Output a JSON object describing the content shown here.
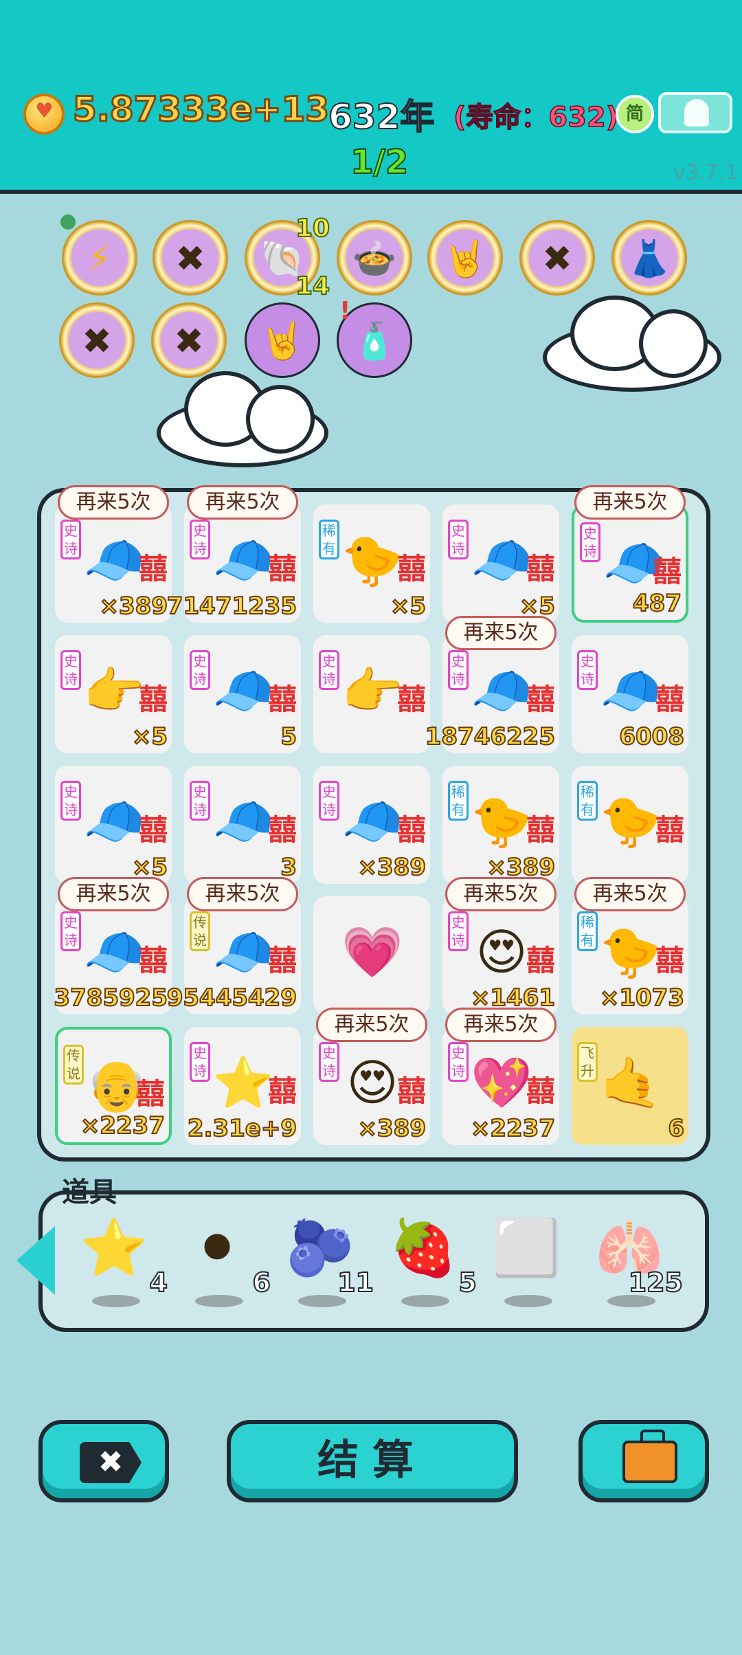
{
  "header": {
    "money": "5.87333e+13",
    "year": "632年",
    "lifespan": "(寿命：632)",
    "stage": "1/2",
    "simplified": "简",
    "version": "v3.7.1"
  },
  "buffs": {
    "shell_top": "10",
    "shell_bottom": "14",
    "alert": "!"
  },
  "board": {
    "tags": {
      "epic": "史诗",
      "rare": "稀有",
      "legend": "传说",
      "fly": "飞升"
    },
    "xi": "囍",
    "bubble": "再来5次",
    "tiles": [
      {
        "tag": "epic",
        "art": "green-hat-man",
        "count": "×389",
        "bubble": true
      },
      {
        "tag": "epic",
        "art": "green-hat-man",
        "count": "71471235",
        "bubble": true
      },
      {
        "tag": "rare",
        "art": "chick",
        "count": "×5"
      },
      {
        "tag": "epic",
        "art": "green-hat-man",
        "count": "×5"
      },
      {
        "tag": "epic",
        "art": "green-hat-man",
        "count": "487",
        "bubble": true,
        "green": true
      },
      {
        "tag": "epic",
        "art": "pointing-hand",
        "count": "×5"
      },
      {
        "tag": "epic",
        "art": "green-hat-man",
        "count": "5"
      },
      {
        "tag": "epic",
        "art": "pointing-hand",
        "count": ""
      },
      {
        "tag": "epic",
        "art": "green-hat-man",
        "count": "18746225",
        "bubble": true
      },
      {
        "tag": "epic",
        "art": "green-hat-man",
        "count": "6008"
      },
      {
        "tag": "epic",
        "art": "green-hat-man",
        "count": "×5"
      },
      {
        "tag": "epic",
        "art": "green-hat-man",
        "count": "3"
      },
      {
        "tag": "epic",
        "art": "green-hat-man",
        "count": "×389"
      },
      {
        "tag": "rare",
        "art": "chick",
        "count": "×389"
      },
      {
        "tag": "rare",
        "art": "chick",
        "count": ""
      },
      {
        "tag": "epic",
        "art": "green-hat-man",
        "count": "3785925",
        "bubble": true
      },
      {
        "tag": "legend",
        "art": "green-hat-man",
        "count": "95445429",
        "bubble": true
      },
      {
        "tag": "",
        "art": "heart",
        "count": ""
      },
      {
        "tag": "epic",
        "art": "heart-eyes-man",
        "count": "×1461",
        "bubble": true
      },
      {
        "tag": "rare",
        "art": "chick",
        "count": "×1073",
        "bubble": true
      },
      {
        "tag": "legend",
        "art": "old-man",
        "count": "×2237",
        "green": true
      },
      {
        "tag": "epic",
        "art": "stars",
        "count": "2.31e+9"
      },
      {
        "tag": "epic",
        "art": "heart-eyes-man",
        "count": "×389",
        "bubble": true
      },
      {
        "tag": "epic",
        "art": "heart-girl",
        "count": "×2237",
        "bubble": true
      },
      {
        "tag": "fly",
        "art": "yellow-hand",
        "count": "6",
        "gold": true
      }
    ]
  },
  "props": {
    "title": "道具",
    "items": [
      {
        "icon": "star-icon",
        "count": "4"
      },
      {
        "icon": "black-hole-icon",
        "count": "6"
      },
      {
        "icon": "blueberry-icon",
        "count": "11"
      },
      {
        "icon": "strawberry-icon",
        "count": "5"
      },
      {
        "icon": "frame-icon",
        "count": ""
      },
      {
        "icon": "liver-icon",
        "count": "125"
      }
    ]
  },
  "actions": {
    "settle_label": "结算"
  },
  "colors": {
    "teal": "#14c8c6",
    "board": "#cfe8ec",
    "gold": "#f9d948",
    "outline": "#1f2a33"
  }
}
